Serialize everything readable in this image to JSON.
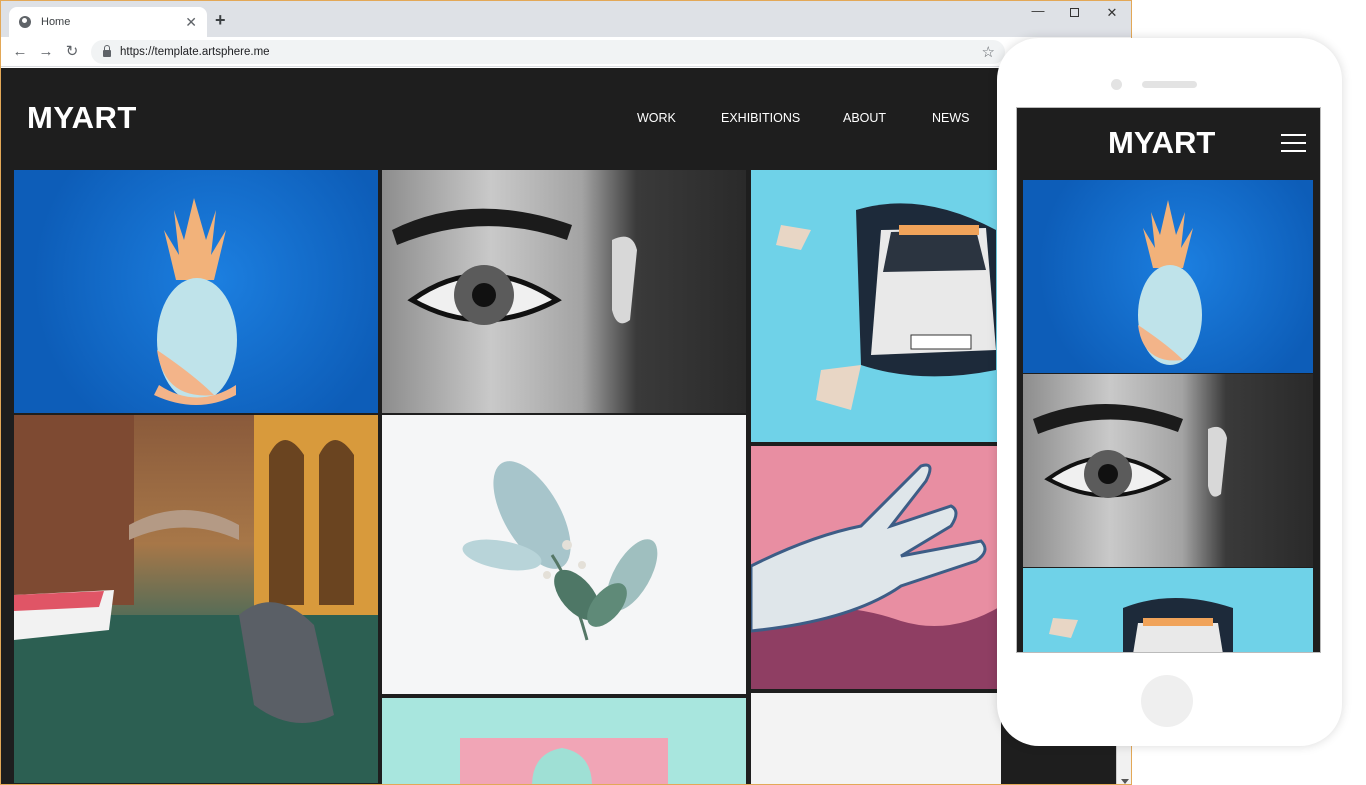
{
  "browser": {
    "tab_title": "Home",
    "new_tab_symbol": "+",
    "url": "https://template.artsphere.me",
    "icons": {
      "tab": "globe-icon",
      "back": "back-arrow-icon",
      "forward": "forward-arrow-icon",
      "reload": "reload-icon",
      "lock": "lock-icon",
      "bookmark": "star-icon",
      "minimize": "minimize-icon",
      "maximize": "maximize-icon",
      "close": "close-icon"
    }
  },
  "site": {
    "logo": "MYART",
    "nav": [
      {
        "label": "WORK"
      },
      {
        "label": "EXHIBITIONS"
      },
      {
        "label": "ABOUT"
      },
      {
        "label": "NEWS"
      }
    ],
    "gallery": [
      "pineapple-artwork",
      "eye-mural-artwork",
      "car-mural-artwork",
      "venice-canal-photo",
      "flower-still-life",
      "painted-hand-artwork",
      "mint-bust-artwork",
      "white-sculpture-artwork"
    ]
  },
  "phone": {
    "logo": "MYART",
    "menu_icon": "hamburger-icon"
  },
  "colors": {
    "page_bg": "#1e1e1e",
    "nav_text": "#ffffff",
    "window_border": "#e3a857"
  }
}
